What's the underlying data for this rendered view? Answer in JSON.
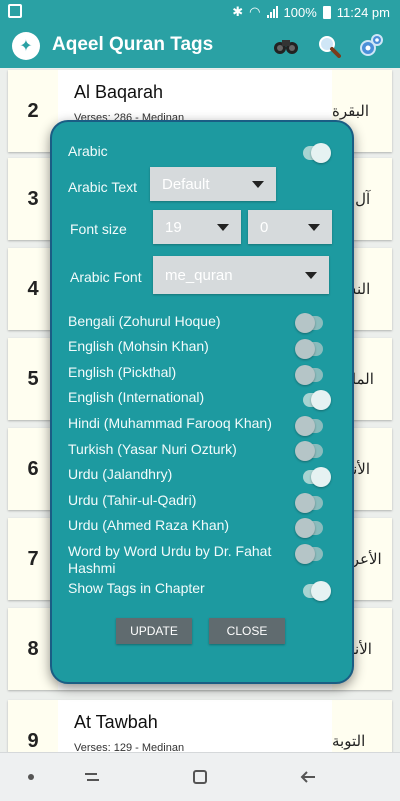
{
  "status_bar": {
    "battery": "100%",
    "time": "11:24 pm"
  },
  "app": {
    "title": "Aqeel Quran Tags"
  },
  "chapters": [
    {
      "num": "2",
      "name": "Al Baqarah",
      "meta": "Verses: 286 - Medinan",
      "arabic": "البقرة"
    },
    {
      "num": "3",
      "name": "",
      "meta": "",
      "arabic": "آل عم"
    },
    {
      "num": "4",
      "name": "",
      "meta": "",
      "arabic": "النساء"
    },
    {
      "num": "5",
      "name": "",
      "meta": "",
      "arabic": "المائدة"
    },
    {
      "num": "6",
      "name": "",
      "meta": "",
      "arabic": "الأنعام"
    },
    {
      "num": "7",
      "name": "",
      "meta": "",
      "arabic": "الأعراف"
    },
    {
      "num": "8",
      "name": "",
      "meta": "",
      "arabic": "الأنفال"
    },
    {
      "num": "9",
      "name": "At Tawbah",
      "meta": "Verses: 129 - Medinan",
      "arabic": "التوبة"
    }
  ],
  "dialog": {
    "arabic_label": "Arabic",
    "arabic_on": true,
    "arabic_text_label": "Arabic Text",
    "arabic_text_value": "Default",
    "font_size_label": "Font size",
    "font_size_value": "19",
    "font_size_secondary": "0",
    "arabic_font_label": "Arabic Font",
    "arabic_font_value": "me_quran",
    "translations": [
      {
        "label": "Bengali (Zohurul Hoque)",
        "on": false
      },
      {
        "label": "English (Mohsin Khan)",
        "on": false
      },
      {
        "label": "English (Pickthal)",
        "on": false
      },
      {
        "label": "English (International)",
        "on": true
      },
      {
        "label": "Hindi (Muhammad Farooq Khan)",
        "on": false
      },
      {
        "label": "Turkish (Yasar Nuri Ozturk)",
        "on": false
      },
      {
        "label": "Urdu (Jalandhry)",
        "on": true
      },
      {
        "label": "Urdu (Tahir-ul-Qadri)",
        "on": false
      },
      {
        "label": "Urdu (Ahmed Raza Khan)",
        "on": false
      },
      {
        "label": "Word by Word Urdu by Dr. Fahat Hashmi",
        "on": false
      },
      {
        "label": "Show Tags in Chapter",
        "on": true
      }
    ],
    "update_label": "UPDATE",
    "close_label": "CLOSE"
  }
}
